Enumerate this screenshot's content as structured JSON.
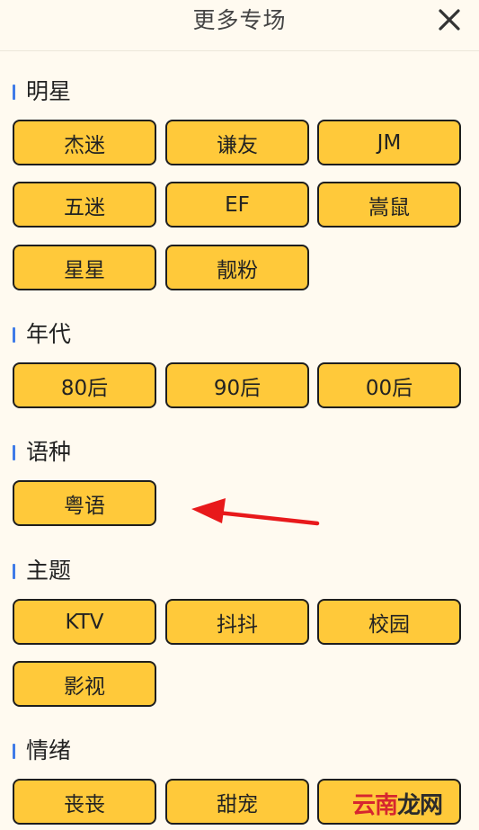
{
  "header": {
    "title": "更多专场",
    "close_icon": "close-icon"
  },
  "sections": [
    {
      "title": "明星",
      "tags": [
        "杰迷",
        "谦友",
        "JM",
        "五迷",
        "EF",
        "嵩鼠",
        "星星",
        "靓粉"
      ]
    },
    {
      "title": "年代",
      "tags": [
        "80后",
        "90后",
        "00后"
      ]
    },
    {
      "title": "语种",
      "tags": [
        "粤语"
      ]
    },
    {
      "title": "主题",
      "tags": [
        "KTV",
        "抖抖",
        "校园",
        "影视"
      ]
    },
    {
      "title": "情绪",
      "tags": [
        "丧丧",
        "甜宠",
        ""
      ]
    }
  ],
  "colors": {
    "background": "#fffaf0",
    "tag_fill": "#ffc93a",
    "tag_border": "#1e1e1e",
    "section_marker": "#3f7be8",
    "arrow": "#e8191b"
  },
  "watermark": {
    "part1": "云南",
    "part2": "龙网"
  }
}
